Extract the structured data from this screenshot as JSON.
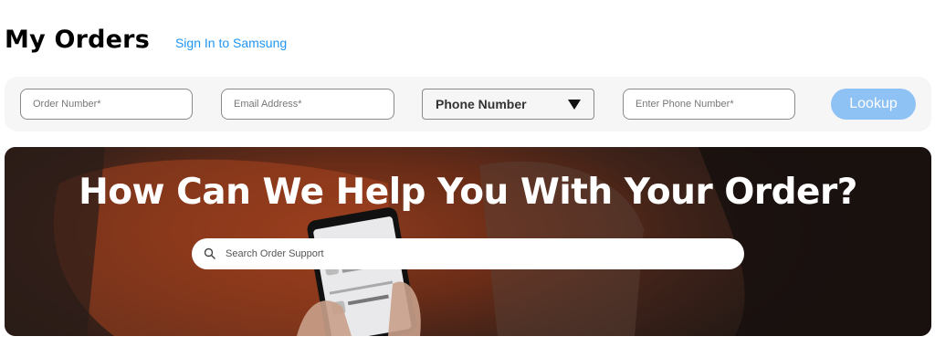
{
  "header": {
    "title": "My Orders",
    "sign_in_link": "Sign In to Samsung"
  },
  "lookup": {
    "order_number_placeholder": "Order Number*",
    "email_placeholder": "Email Address*",
    "contact_type_selected": "Phone Number",
    "phone_placeholder": "Enter Phone Number*",
    "button_label": "Lookup",
    "button_color": "#8ec2f5"
  },
  "hero": {
    "title": "How Can We Help You With Your Order?",
    "search_placeholder": "Search Order Support",
    "icons": [
      "search-icon"
    ]
  },
  "colors": {
    "link": "#2196f3",
    "panel": "#f6f6f6"
  }
}
